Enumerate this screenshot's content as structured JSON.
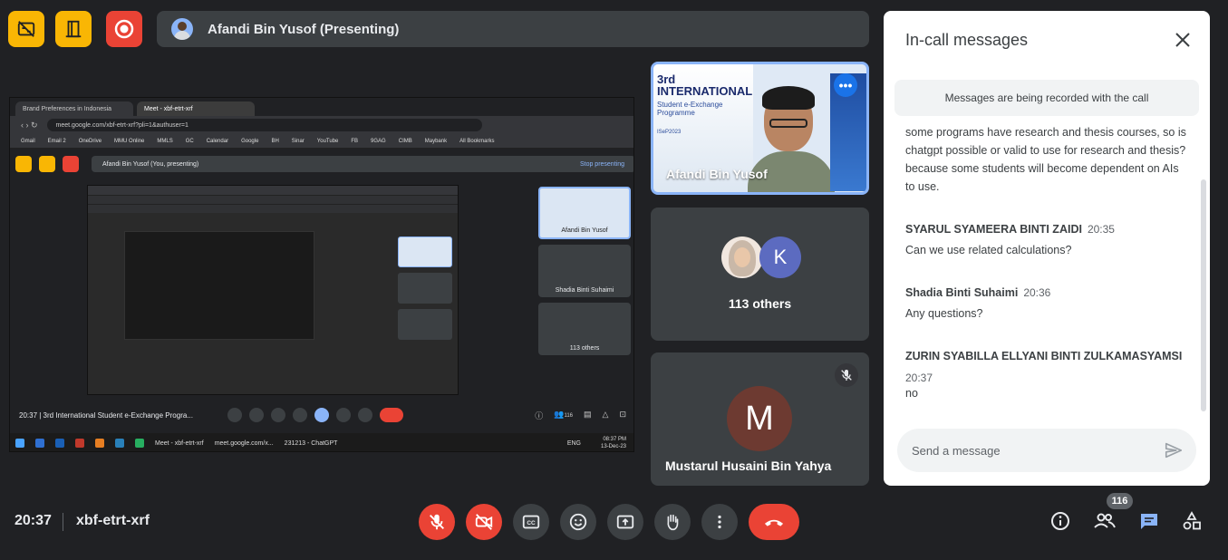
{
  "top": {
    "presenter_name": "Afandi Bin Yusof (Presenting)"
  },
  "screen": {
    "tab1": "Brand Preferences in Indonesia",
    "tab2": "Meet - xbf-etrt-xrf",
    "url": "meet.google.com/xbf-etrt-xrf?pli=1&authuser=1",
    "bookmarks": [
      "Gmail",
      "Email 2",
      "OneDrive",
      "MMU Online",
      "MMLS",
      "GC",
      "Calendar",
      "Google",
      "BH",
      "Sinar",
      "YouTube",
      "FB",
      "9GAG",
      "CIMB",
      "Maybank",
      "All Bookmarks"
    ],
    "presenting": "Afandi Bin Yusof (You, presenting)",
    "stop": "Stop presenting",
    "tile_first": "Afandi Bin Yusof",
    "tile_second": "Shadia Binti Suhaimi",
    "tile_third": "113 others",
    "ctrl_text": "20:37  |  3rd International Student e-Exchange Progra...",
    "badge": "116",
    "taskbar_meet": "Meet - xbf-etrt-xrf",
    "taskbar_url": "meet.google.com/x...",
    "taskbar_chat": "231213 - ChatGPT",
    "lang": "ENG",
    "clock_time": "08:37 PM",
    "clock_date": "13-Dec-23"
  },
  "tiles": {
    "presenter_label": "Afandi Bin Yusof",
    "poster_line1": "3rd",
    "poster_line2": "INTERNATIONAL",
    "poster_line3": "Student e-Exchange Programme",
    "poster_line4": "ISeP2023",
    "others_initial": "K",
    "others_label": "113 others",
    "musta_initial": "M",
    "musta_label": "Mustarul Husaini Bin Yahya"
  },
  "chat": {
    "title": "In-call messages",
    "notice": "Messages are being recorded with the call",
    "msg0_text": "some programs have research and thesis courses, so is chatgpt possible or valid to use for research and thesis? because some students will become dependent on AIs to use.",
    "messages": [
      {
        "sender": "SYARUL SYAMEERA BINTI ZAIDI",
        "time": "20:35",
        "text": "Can we use related calculations?"
      },
      {
        "sender": "Shadia Binti Suhaimi",
        "time": "20:36",
        "text": "Any questions?"
      },
      {
        "sender": "ZURIN SYABILLA ELLYANI BINTI ZULKAMASYAMSI",
        "time": "20:37",
        "text": "no"
      }
    ],
    "placeholder": "Send a message"
  },
  "bottom": {
    "time": "20:37",
    "meeting_code": "xbf-etrt-xrf",
    "participants_badge": "116"
  },
  "colors": {
    "background": "#202124",
    "surface": "#3c4043",
    "red": "#ea4335",
    "yellow": "#f9b604",
    "blue": "#8ab4f8",
    "chat_active": "#8ab4f8"
  }
}
